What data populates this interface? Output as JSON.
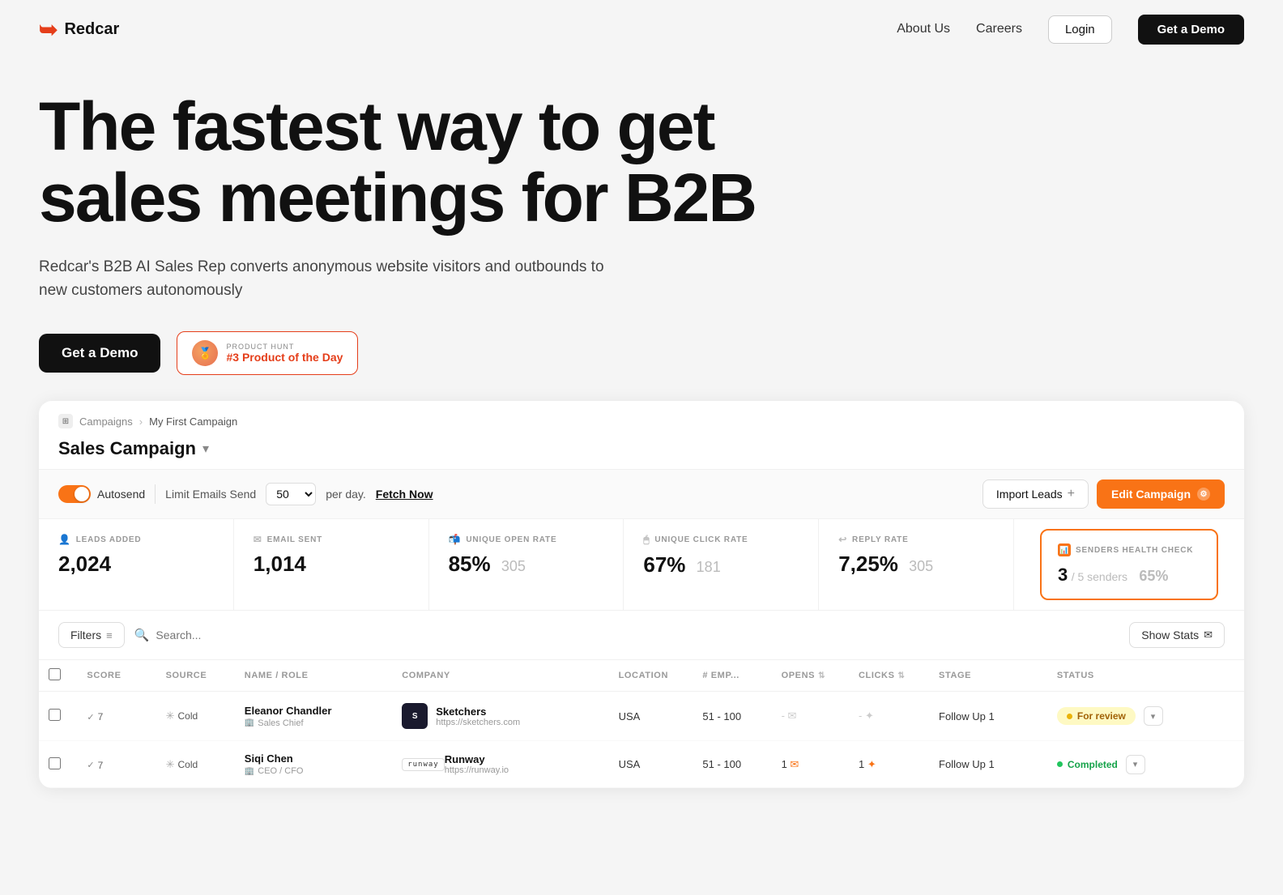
{
  "nav": {
    "logo_text": "Redcar",
    "links": [
      {
        "label": "About Us",
        "id": "about-us"
      },
      {
        "label": "Careers",
        "id": "careers"
      }
    ],
    "login_label": "Login",
    "demo_label": "Get a Demo"
  },
  "hero": {
    "title": "The fastest way to get sales meetings for B2B",
    "subtitle": "Redcar's B2B AI Sales Rep converts anonymous website visitors and outbounds to new customers autonomously",
    "demo_btn": "Get a Demo",
    "ph_label": "PRODUCT HUNT",
    "ph_rank": "#3 Product of the Day"
  },
  "campaign": {
    "breadcrumb_icon": "⊞",
    "breadcrumb_parent": "Campaigns",
    "breadcrumb_current": "My First Campaign",
    "title": "Sales Campaign",
    "autosend_label": "Autosend",
    "limit_label": "Limit Emails Send",
    "limit_value": "50",
    "per_day_label": "per day.",
    "fetch_now_label": "Fetch Now",
    "import_btn": "Import Leads",
    "edit_btn": "Edit Campaign",
    "stats": {
      "leads_added_label": "LEADS ADDED",
      "leads_added_value": "2,024",
      "email_sent_label": "EMAIL SENT",
      "email_sent_value": "1,014",
      "open_rate_label": "UNIQUE OPEN RATE",
      "open_rate_pct": "85%",
      "open_rate_count": "305",
      "click_rate_label": "UNIQUE CLICK RATE",
      "click_rate_pct": "67%",
      "click_rate_count": "181",
      "reply_rate_label": "REPLY RATE",
      "reply_rate_pct": "7,25%",
      "reply_rate_count": "305",
      "health_label": "SENDERS HEALTH CHECK",
      "health_value": "3",
      "health_total": "/ 5 senders",
      "health_pct": "65%"
    },
    "filters_btn": "Filters",
    "search_placeholder": "Search...",
    "show_stats_btn": "Show Stats",
    "table": {
      "headers": [
        "",
        "SCORE",
        "SOURCE",
        "NAME / ROLE",
        "COMPANY",
        "LOCATION",
        "# EMP...",
        "OPENS",
        "CLICKS",
        "STAGE",
        "STATUS",
        ""
      ],
      "rows": [
        {
          "score": "7",
          "source": "Cold",
          "name": "Eleanor Chandler",
          "role": "Sales Chief",
          "company_name": "Sketchers",
          "company_url": "https://sketchers.com",
          "company_color": "#1a1a2e",
          "company_abbr": "S",
          "location": "USA",
          "emp": "51 - 100",
          "opens": "-",
          "clicks": "-",
          "stage": "Follow Up 1",
          "status": "For review",
          "status_type": "review"
        },
        {
          "score": "7",
          "source": "Cold",
          "name": "Siqi Chen",
          "role": "CEO / CFO",
          "company_name": "Runway",
          "company_url": "https://runway.io",
          "company_color": "#111",
          "company_abbr": "R",
          "location": "USA",
          "emp": "51 - 100",
          "opens": "1",
          "clicks": "1",
          "stage": "Follow Up 1",
          "status": "Completed",
          "status_type": "completed"
        }
      ]
    }
  }
}
